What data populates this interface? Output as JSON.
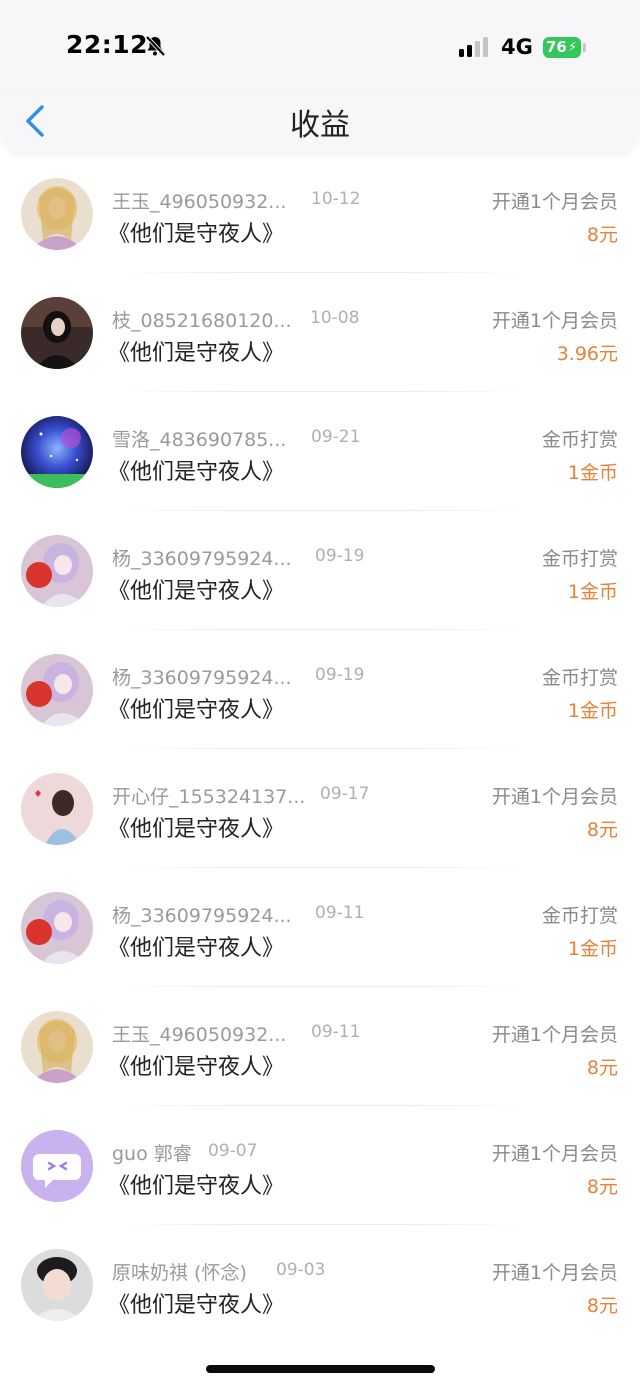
{
  "status": {
    "time": "22:12",
    "network": "4G",
    "battery": "76"
  },
  "nav": {
    "title": "收益"
  },
  "items": [
    {
      "user": "王玉_496050932...",
      "date": "10-12",
      "book": "《他们是守夜人》",
      "type": "开通1个月会员",
      "amount": "8元",
      "avatar": "anime-girl-blonde"
    },
    {
      "user": "枝_08521680120...",
      "date": "10-08",
      "book": "《他们是守夜人》",
      "type": "开通1个月会员",
      "amount": "3.96元",
      "avatar": "dark-portrait"
    },
    {
      "user": "雪洛_483690785...",
      "date": "09-21",
      "book": "《他们是守夜人》",
      "type": "金币打赏",
      "amount": "1金币",
      "avatar": "galaxy"
    },
    {
      "user": "杨_33609795924...",
      "date": "09-19",
      "book": "《他们是守夜人》",
      "type": "金币打赏",
      "amount": "1金币",
      "avatar": "anime-girl-lantern"
    },
    {
      "user": "杨_33609795924...",
      "date": "09-19",
      "book": "《他们是守夜人》",
      "type": "金币打赏",
      "amount": "1金币",
      "avatar": "anime-girl-lantern"
    },
    {
      "user": "开心仔_155324137...",
      "date": "09-17",
      "book": "《他们是守夜人》",
      "type": "开通1个月会员",
      "amount": "8元",
      "avatar": "pink-girl"
    },
    {
      "user": "杨_33609795924...",
      "date": "09-11",
      "book": "《他们是守夜人》",
      "type": "金币打赏",
      "amount": "1金币",
      "avatar": "anime-girl-lantern"
    },
    {
      "user": "王玉_496050932...",
      "date": "09-11",
      "book": "《他们是守夜人》",
      "type": "开通1个月会员",
      "amount": "8元",
      "avatar": "anime-girl-blonde"
    },
    {
      "user": "guo 郭睿",
      "date": "09-07",
      "book": "《他们是守夜人》",
      "type": "开通1个月会员",
      "amount": "8元",
      "avatar": "chat-bubble"
    },
    {
      "user": "原味奶祺 (怀念)",
      "date": "09-03",
      "book": "《他们是守夜人》",
      "type": "开通1个月会员",
      "amount": "8元",
      "avatar": "boy-portrait"
    }
  ]
}
